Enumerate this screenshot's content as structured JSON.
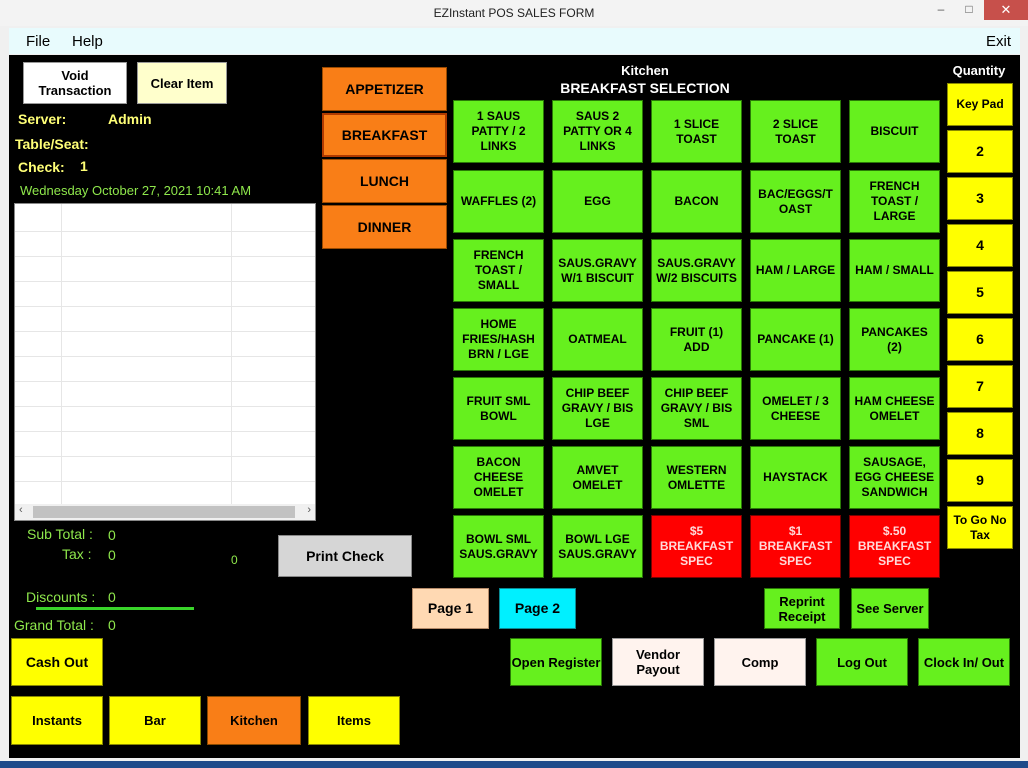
{
  "window": {
    "title": "EZInstant POS SALES FORM",
    "minimize": "–",
    "maximize": "□",
    "close": "✕"
  },
  "menu": {
    "file": "File",
    "help": "Help",
    "exit": "Exit"
  },
  "left": {
    "void_label": "Void Transaction",
    "clear_label": "Clear Item",
    "server_label": "Server:",
    "server_value": "Admin",
    "table_seat_label": "Table/Seat:",
    "check_label": "Check:",
    "check_value": "1",
    "datetime": "Wednesday October 27, 2021  10:41  AM",
    "subtotal_label": "Sub Total :",
    "subtotal_value": "0",
    "tax_label": "Tax :",
    "tax_value": "0",
    "mid_value": "0",
    "print_check": "Print Check",
    "discounts_label": "Discounts :",
    "discounts_value": "0",
    "grand_total_label": "Grand Total :",
    "grand_total_value": "0",
    "cash_out": "Cash Out"
  },
  "categories": [
    {
      "label": "APPETIZER"
    },
    {
      "label": "BREAKFAST"
    },
    {
      "label": "LUNCH"
    },
    {
      "label": "DINNER"
    }
  ],
  "header": {
    "kitchen": "Kitchen",
    "selection": "BREAKFAST  SELECTION",
    "quantity": "Quantity"
  },
  "items": [
    [
      "1 SAUS PATTY / 2 LINKS",
      "SAUS 2 PATTY OR 4 LINKS",
      "1 SLICE TOAST",
      "2 SLICE TOAST",
      "BISCUIT"
    ],
    [
      "WAFFLES (2)",
      "EGG",
      "BACON",
      "BAC/EGGS/T OAST",
      "FRENCH TOAST / LARGE"
    ],
    [
      "FRENCH TOAST / SMALL",
      "SAUS.GRAVY W/1 BISCUIT",
      "SAUS.GRAVY W/2 BISCUITS",
      "HAM / LARGE",
      "HAM / SMALL"
    ],
    [
      "HOME FRIES/HASH BRN / LGE",
      "OATMEAL",
      "FRUIT (1) ADD",
      "PANCAKE (1)",
      "PANCAKES (2)"
    ],
    [
      "FRUIT SML BOWL",
      "CHIP BEEF GRAVY / BIS LGE",
      "CHIP BEEF GRAVY / BIS SML",
      "OMELET / 3 CHEESE",
      "HAM CHEESE OMELET"
    ],
    [
      "BACON CHEESE OMELET",
      "AMVET OMELET",
      "WESTERN OMLETTE",
      "HAYSTACK",
      "SAUSAGE, EGG CHEESE SANDWICH"
    ],
    [
      "BOWL SML SAUS.GRAVY",
      "BOWL LGE SAUS.GRAVY",
      "$5 BREAKFAST SPEC",
      "$1 BREAKFAST SPEC",
      "$.50 BREAKFAST SPEC"
    ]
  ],
  "red_items": [
    "$5 BREAKFAST SPEC",
    "$1 BREAKFAST SPEC",
    "$.50 BREAKFAST SPEC"
  ],
  "quantity": [
    "Key Pad",
    "2",
    "3",
    "4",
    "5",
    "6",
    "7",
    "8",
    "9",
    "To Go No Tax"
  ],
  "pages": {
    "page1": "Page 1",
    "page2": "Page 2"
  },
  "actions": {
    "reprint": "Reprint Receipt",
    "see_server": "See Server",
    "open_register": "Open Register",
    "vendor_payout": "Vendor Payout",
    "comp": "Comp",
    "log_out": "Log Out",
    "clock_in_out": "Clock In/ Out"
  },
  "bottom_tabs": [
    "Instants",
    "Bar",
    "Kitchen",
    "Items"
  ],
  "colors": {
    "green": "#66f01e",
    "red": "#ff0000",
    "yellow": "#ffff00",
    "orange": "#f97e17",
    "peach": "#ffd9b3",
    "cyan": "#00f0ff"
  }
}
